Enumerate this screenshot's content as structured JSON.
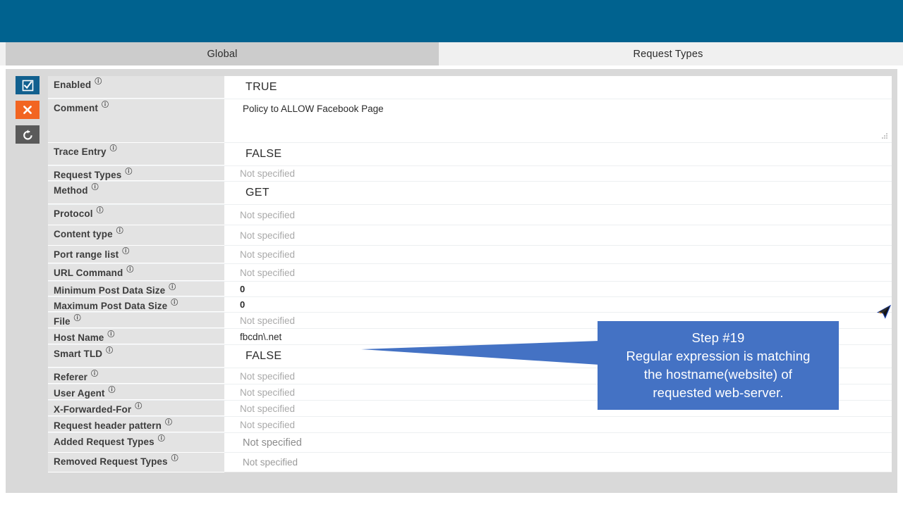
{
  "window": {
    "banner_color": "#00628f",
    "panel_color": "#d9d9d9"
  },
  "tabs": [
    {
      "label": "Global",
      "active": true
    },
    {
      "label": "Request Types",
      "active": false
    }
  ],
  "toolbar": {
    "apply_label": "apply",
    "cancel_label": "cancel",
    "revert_label": "revert",
    "apply_color": "#11608f",
    "cancel_color": "#f26522",
    "revert_color": "#5a5a5a"
  },
  "form": {
    "info_glyph": "ℹ",
    "rows": [
      {
        "label": "Enabled",
        "value": "TRUE",
        "kind": "select"
      },
      {
        "label": "Comment",
        "value": "Policy to ALLOW Facebook Page",
        "kind": "textarea"
      },
      {
        "label": "Trace Entry",
        "value": "FALSE",
        "kind": "select"
      },
      {
        "label": "Request Types",
        "value": "Not specified",
        "kind": "placeholder"
      },
      {
        "label": "Method",
        "value": "GET",
        "kind": "select"
      },
      {
        "label": "Protocol",
        "value": "Not specified",
        "kind": "placeholder"
      },
      {
        "label": "Content type",
        "value": "Not specified",
        "kind": "placeholder"
      },
      {
        "label": "Port range list",
        "value": "Not specified",
        "kind": "placeholder"
      },
      {
        "label": "URL Command",
        "value": "Not specified",
        "kind": "placeholder"
      },
      {
        "label": "Minimum Post Data Size",
        "value": "0",
        "kind": "number"
      },
      {
        "label": "Maximum Post Data Size",
        "value": "0",
        "kind": "number"
      },
      {
        "label": "File",
        "value": "Not specified",
        "kind": "placeholder"
      },
      {
        "label": "Host Name",
        "value": "fbcdn\\.net",
        "kind": "text"
      },
      {
        "label": "Smart TLD",
        "value": "FALSE",
        "kind": "select"
      },
      {
        "label": "Referer",
        "value": "Not specified",
        "kind": "placeholder"
      },
      {
        "label": "User Agent",
        "value": "Not specified",
        "kind": "placeholder"
      },
      {
        "label": "X-Forwarded-For",
        "value": "Not specified",
        "kind": "placeholder"
      },
      {
        "label": "Request header pattern",
        "value": "Not specified",
        "kind": "placeholder"
      },
      {
        "label": "Added Request Types",
        "value": "Not specified",
        "kind": "multiselect"
      },
      {
        "label": "Removed Request Types",
        "value": "Not specified",
        "kind": "multiselect"
      }
    ]
  },
  "callout": {
    "color": "#4472c4",
    "line1": "Step #19",
    "line2": "Regular expression is matching",
    "line3": "the hostname(website) of",
    "line4": "requested web-server."
  }
}
